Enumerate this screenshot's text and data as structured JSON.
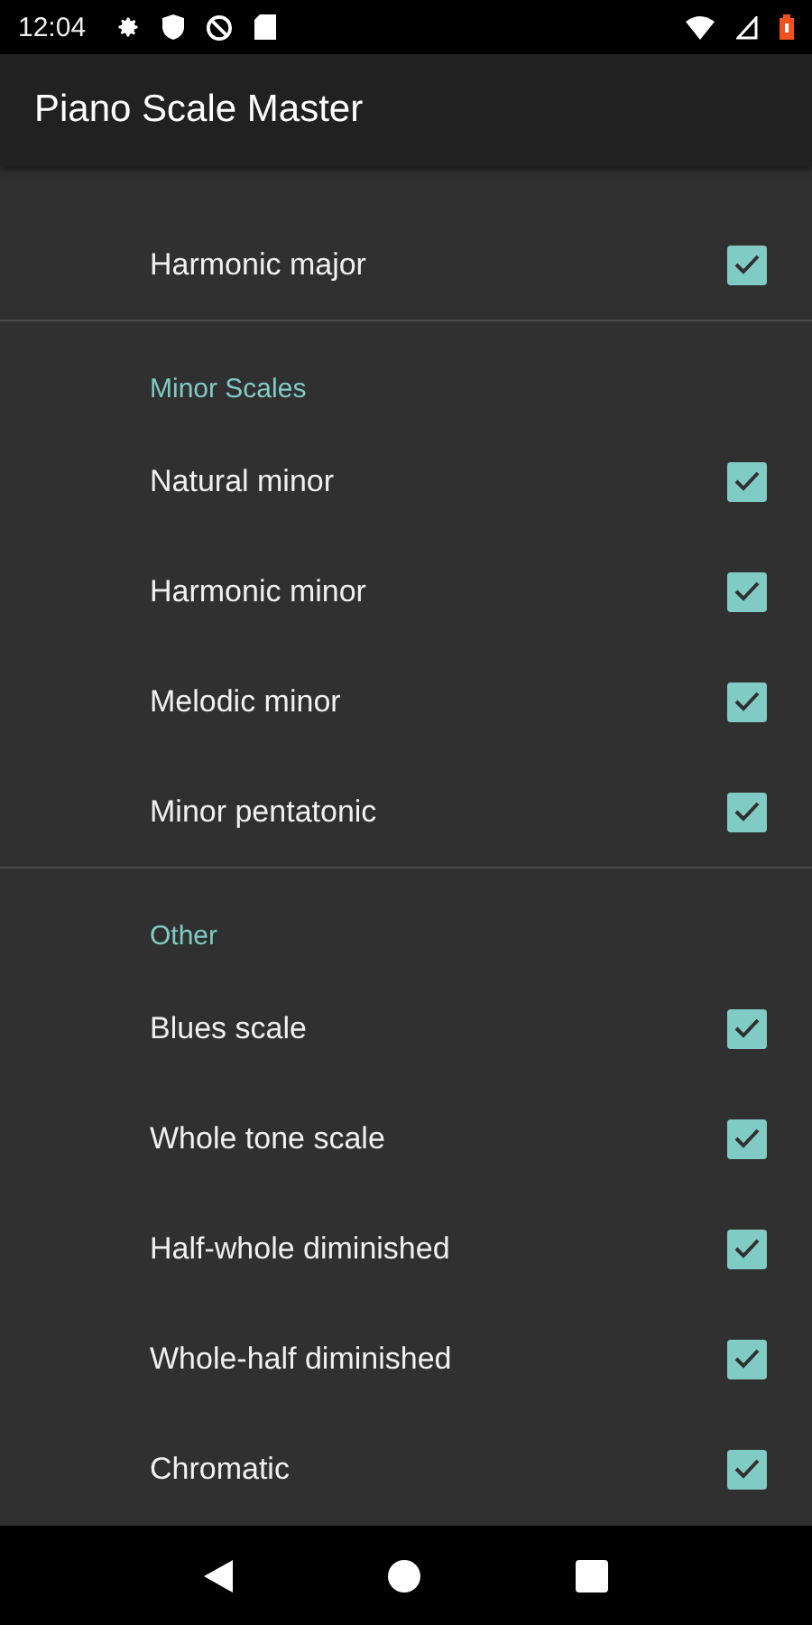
{
  "status_bar": {
    "time": "12:04"
  },
  "app_bar": {
    "title": "Piano Scale Master"
  },
  "sections": [
    {
      "items": [
        {
          "label": "Harmonic major",
          "checked": true
        }
      ]
    },
    {
      "header": "Minor Scales",
      "items": [
        {
          "label": "Natural minor",
          "checked": true
        },
        {
          "label": "Harmonic minor",
          "checked": true
        },
        {
          "label": "Melodic minor",
          "checked": true
        },
        {
          "label": "Minor pentatonic",
          "checked": true
        }
      ]
    },
    {
      "header": "Other",
      "items": [
        {
          "label": "Blues scale",
          "checked": true
        },
        {
          "label": "Whole tone scale",
          "checked": true
        },
        {
          "label": "Half-whole diminished",
          "checked": true
        },
        {
          "label": "Whole-half diminished",
          "checked": true
        },
        {
          "label": "Chromatic",
          "checked": true
        }
      ]
    }
  ]
}
